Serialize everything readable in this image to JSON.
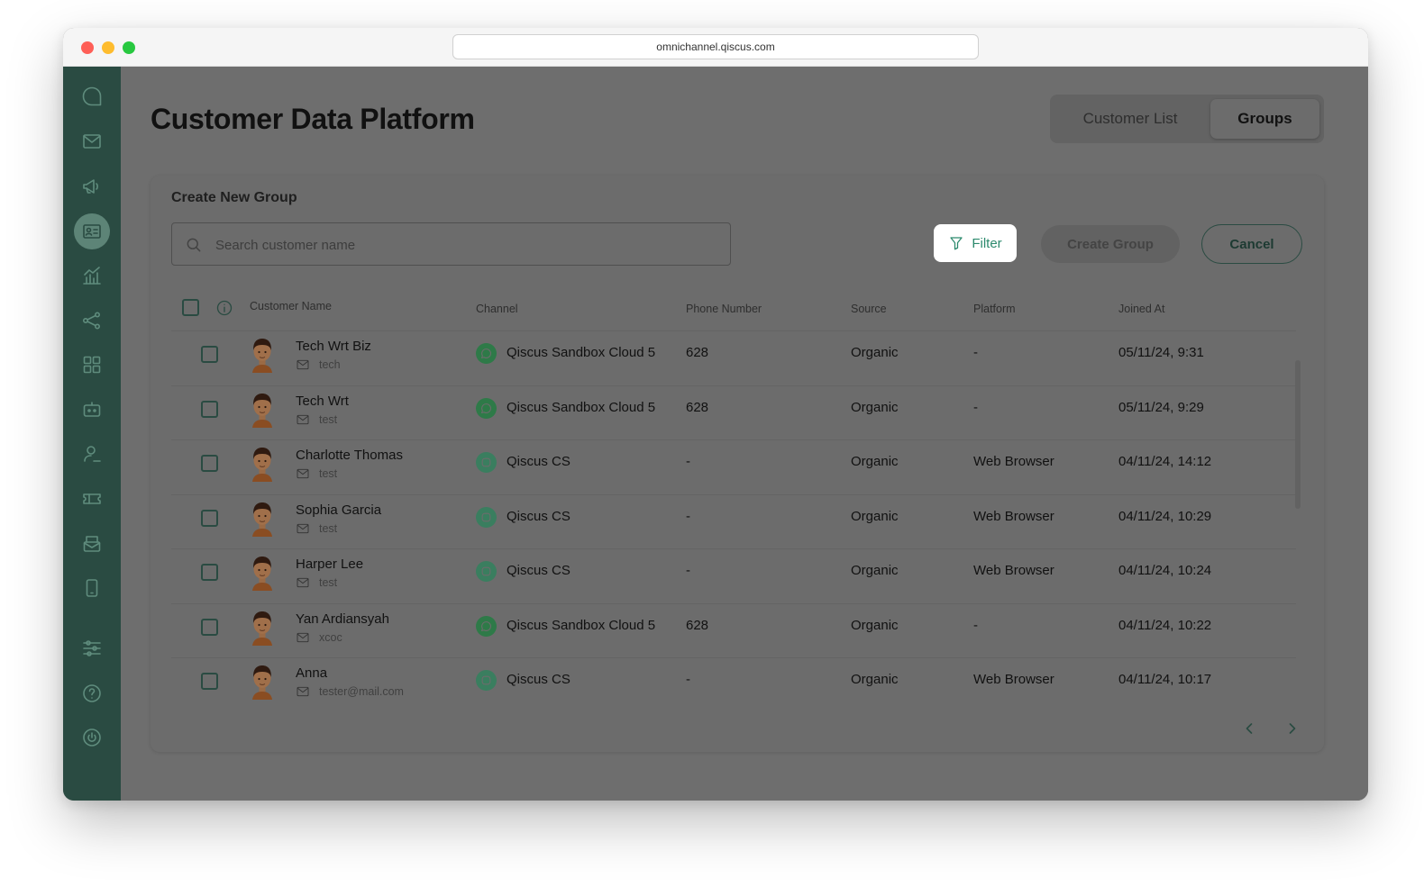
{
  "browser": {
    "url": "omnichannel.qiscus.com"
  },
  "sidebar": {
    "items": [
      {
        "icon": "qiscus-logo-icon",
        "active": false
      },
      {
        "icon": "mail-icon",
        "active": false
      },
      {
        "icon": "megaphone-icon",
        "active": false
      },
      {
        "icon": "contact-card-icon",
        "active": true
      },
      {
        "icon": "analytics-chart-icon",
        "active": false
      },
      {
        "icon": "share-nodes-icon",
        "active": false
      },
      {
        "icon": "apps-grid-icon",
        "active": false
      },
      {
        "icon": "bot-icon",
        "active": false
      },
      {
        "icon": "agent-icon",
        "active": false
      },
      {
        "icon": "ticket-icon",
        "active": false
      },
      {
        "icon": "inbox-icon",
        "active": false
      },
      {
        "icon": "mobile-icon",
        "active": false
      },
      {
        "icon": "settings-sliders-icon",
        "active": false
      },
      {
        "icon": "help-icon",
        "active": false
      },
      {
        "icon": "power-icon",
        "active": false
      }
    ]
  },
  "page": {
    "title": "Customer Data Platform",
    "tabs": [
      {
        "label": "Customer List",
        "active": false
      },
      {
        "label": "Groups",
        "active": true
      }
    ]
  },
  "create_group": {
    "title": "Create New Group",
    "search_placeholder": "Search customer name",
    "search_value": "",
    "filter_label": "Filter",
    "create_label": "Create Group",
    "cancel_label": "Cancel"
  },
  "table": {
    "columns": {
      "name": "Customer Name",
      "channel": "Channel",
      "phone": "Phone Number",
      "source": "Source",
      "platform": "Platform",
      "joined": "Joined At"
    },
    "rows": [
      {
        "name": "Tech Wrt Biz",
        "email": "tech",
        "channel": "Qiscus Sandbox Cloud 5",
        "channel_type": "whatsapp",
        "phone": "628",
        "source": "Organic",
        "platform": "-",
        "joined": "05/11/24, 9:31"
      },
      {
        "name": "Tech Wrt",
        "email": "test",
        "channel": "Qiscus Sandbox Cloud 5",
        "channel_type": "whatsapp",
        "phone": "628",
        "source": "Organic",
        "platform": "-",
        "joined": "05/11/24, 9:29"
      },
      {
        "name": "Charlotte Thomas",
        "email": "test",
        "channel": "Qiscus CS",
        "channel_type": "qiscus",
        "phone": "-",
        "source": "Organic",
        "platform": "Web Browser",
        "joined": "04/11/24, 14:12"
      },
      {
        "name": "Sophia Garcia",
        "email": "test",
        "channel": "Qiscus CS",
        "channel_type": "qiscus",
        "phone": "-",
        "source": "Organic",
        "platform": "Web Browser",
        "joined": "04/11/24, 10:29"
      },
      {
        "name": "Harper Lee",
        "email": "test",
        "channel": "Qiscus CS",
        "channel_type": "qiscus",
        "phone": "-",
        "source": "Organic",
        "platform": "Web Browser",
        "joined": "04/11/24, 10:24"
      },
      {
        "name": "Yan Ardiansyah",
        "email": "xcoc",
        "channel": "Qiscus Sandbox Cloud 5",
        "channel_type": "whatsapp",
        "phone": "628",
        "source": "Organic",
        "platform": "-",
        "joined": "04/11/24, 10:22"
      },
      {
        "name": "Anna",
        "email": "tester@mail.com",
        "channel": "Qiscus CS",
        "channel_type": "qiscus",
        "phone": "-",
        "source": "Organic",
        "platform": "Web Browser",
        "joined": "04/11/24, 10:17"
      }
    ]
  },
  "pagination": {
    "prev_icon": "chevron-left-icon",
    "next_icon": "chevron-right-icon"
  },
  "colors": {
    "sidebar_bg": "#2a4b42",
    "accent_green": "#2c8a6d",
    "overlay_gray": "#6e6e6e",
    "whatsapp_green": "#2e7a48"
  }
}
